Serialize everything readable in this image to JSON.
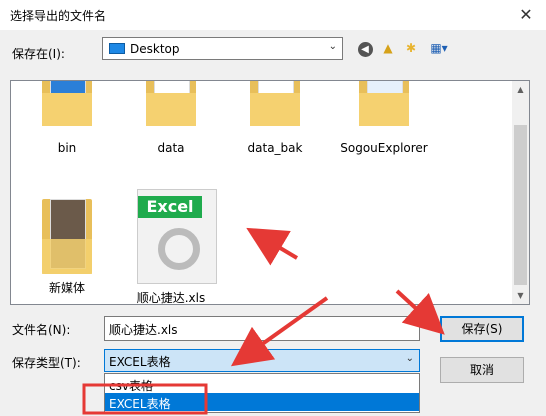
{
  "window": {
    "title": "选择导出的文件名"
  },
  "location": {
    "label": "保存在(I):",
    "value": "Desktop"
  },
  "files": [
    {
      "name": "bin",
      "kind": "folder"
    },
    {
      "name": "data",
      "kind": "folder"
    },
    {
      "name": "data_bak",
      "kind": "folder"
    },
    {
      "name": "SogouExplorer",
      "kind": "folder"
    },
    {
      "name": "新媒体",
      "kind": "folder"
    },
    {
      "name": "顺心捷达.xls",
      "kind": "excel-file"
    }
  ],
  "excel_badge": "Excel",
  "filename": {
    "label": "文件名(N):",
    "value": "顺心捷达.xls"
  },
  "filetype": {
    "label": "保存类型(T):",
    "value": "EXCEL表格",
    "options": [
      "csv表格",
      "EXCEL表格"
    ]
  },
  "buttons": {
    "save": "保存(S)",
    "cancel": "取消"
  },
  "colors": {
    "accent": "#0078d7",
    "annotation_red": "#e53935",
    "excel_green": "#1fab4d"
  }
}
